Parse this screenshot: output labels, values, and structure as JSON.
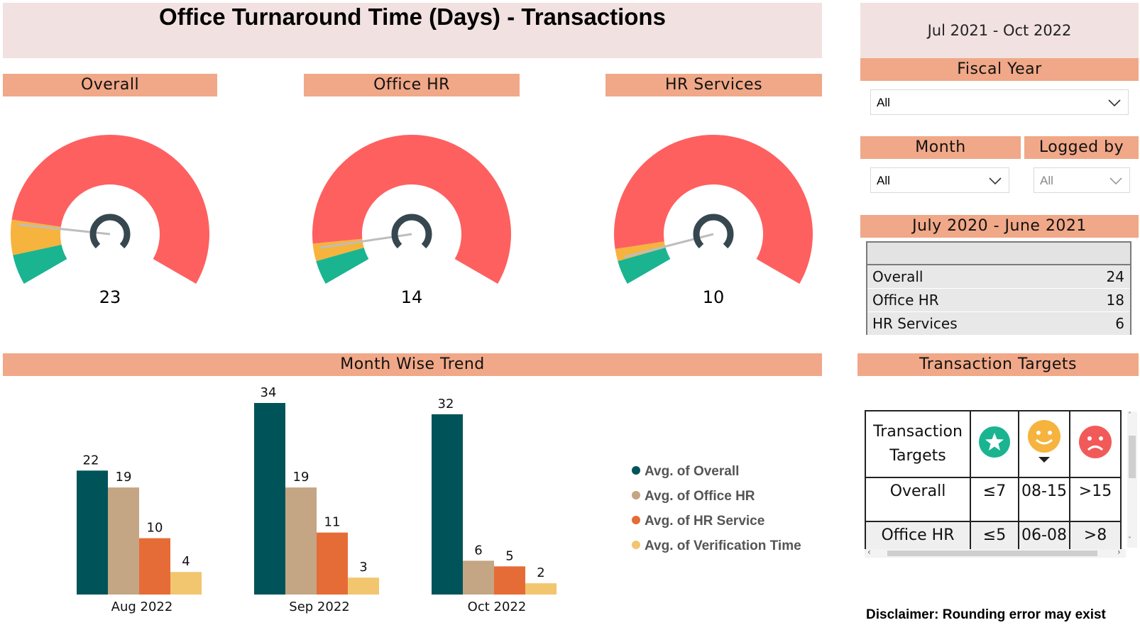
{
  "header": {
    "title": "Office Turnaround Time (Days) - Transactions",
    "date_range": "Jul 2021 - Oct 2022"
  },
  "gauges": [
    {
      "label": "Overall",
      "value": "23",
      "fraction": 0.15
    },
    {
      "label": "Office HR",
      "value": "14",
      "fraction": 0.09
    },
    {
      "label": "HR Services",
      "value": "10",
      "fraction": 0.065
    }
  ],
  "filters": {
    "fiscal_year": {
      "label": "Fiscal Year",
      "selected": "All"
    },
    "month": {
      "label": "Month",
      "selected": "All"
    },
    "logged_by": {
      "label": "Logged by",
      "selected": "All"
    }
  },
  "summary": {
    "title": "July 2020 - June 2021",
    "rows": [
      {
        "name": "Overall",
        "value": "24"
      },
      {
        "name": "Office HR",
        "value": "18"
      },
      {
        "name": "HR Services",
        "value": "6"
      }
    ]
  },
  "trend": {
    "title": "Month Wise Trend"
  },
  "chart_data": {
    "type": "bar",
    "categories": [
      "Aug 2022",
      "Sep 2022",
      "Oct 2022"
    ],
    "series": [
      {
        "name": "Avg. of Overall",
        "color": "#005459",
        "values": [
          22,
          34,
          32
        ]
      },
      {
        "name": "Avg. of Office HR",
        "color": "#c4a584",
        "values": [
          19,
          19,
          6
        ]
      },
      {
        "name": "Avg. of HR Service",
        "color": "#e66c37",
        "values": [
          10,
          11,
          5
        ]
      },
      {
        "name": "Avg. of Verification Time",
        "color": "#f2c56f",
        "values": [
          4,
          3,
          2
        ]
      }
    ],
    "title": "Month Wise Trend",
    "legend": "right"
  },
  "targets": {
    "title": "Transaction Targets",
    "header_label": "Transaction Targets",
    "icons": [
      "star-icon",
      "smiley-happy-icon",
      "smiley-sad-icon"
    ],
    "rows": [
      {
        "name": "Overall",
        "good": "≤7",
        "ok": "08-15",
        "bad": ">15"
      },
      {
        "name": "Office HR",
        "good": "≤5",
        "ok": "06-08",
        "bad": ">8"
      }
    ]
  },
  "disclaimer": "Disclaimer: Rounding error may exist",
  "colors": {
    "band": "#f0a888",
    "gauge_red": "#fe6060",
    "gauge_yellow": "#f6b33d",
    "gauge_green": "#1ab491",
    "title_bg": "#f1e1e0"
  }
}
